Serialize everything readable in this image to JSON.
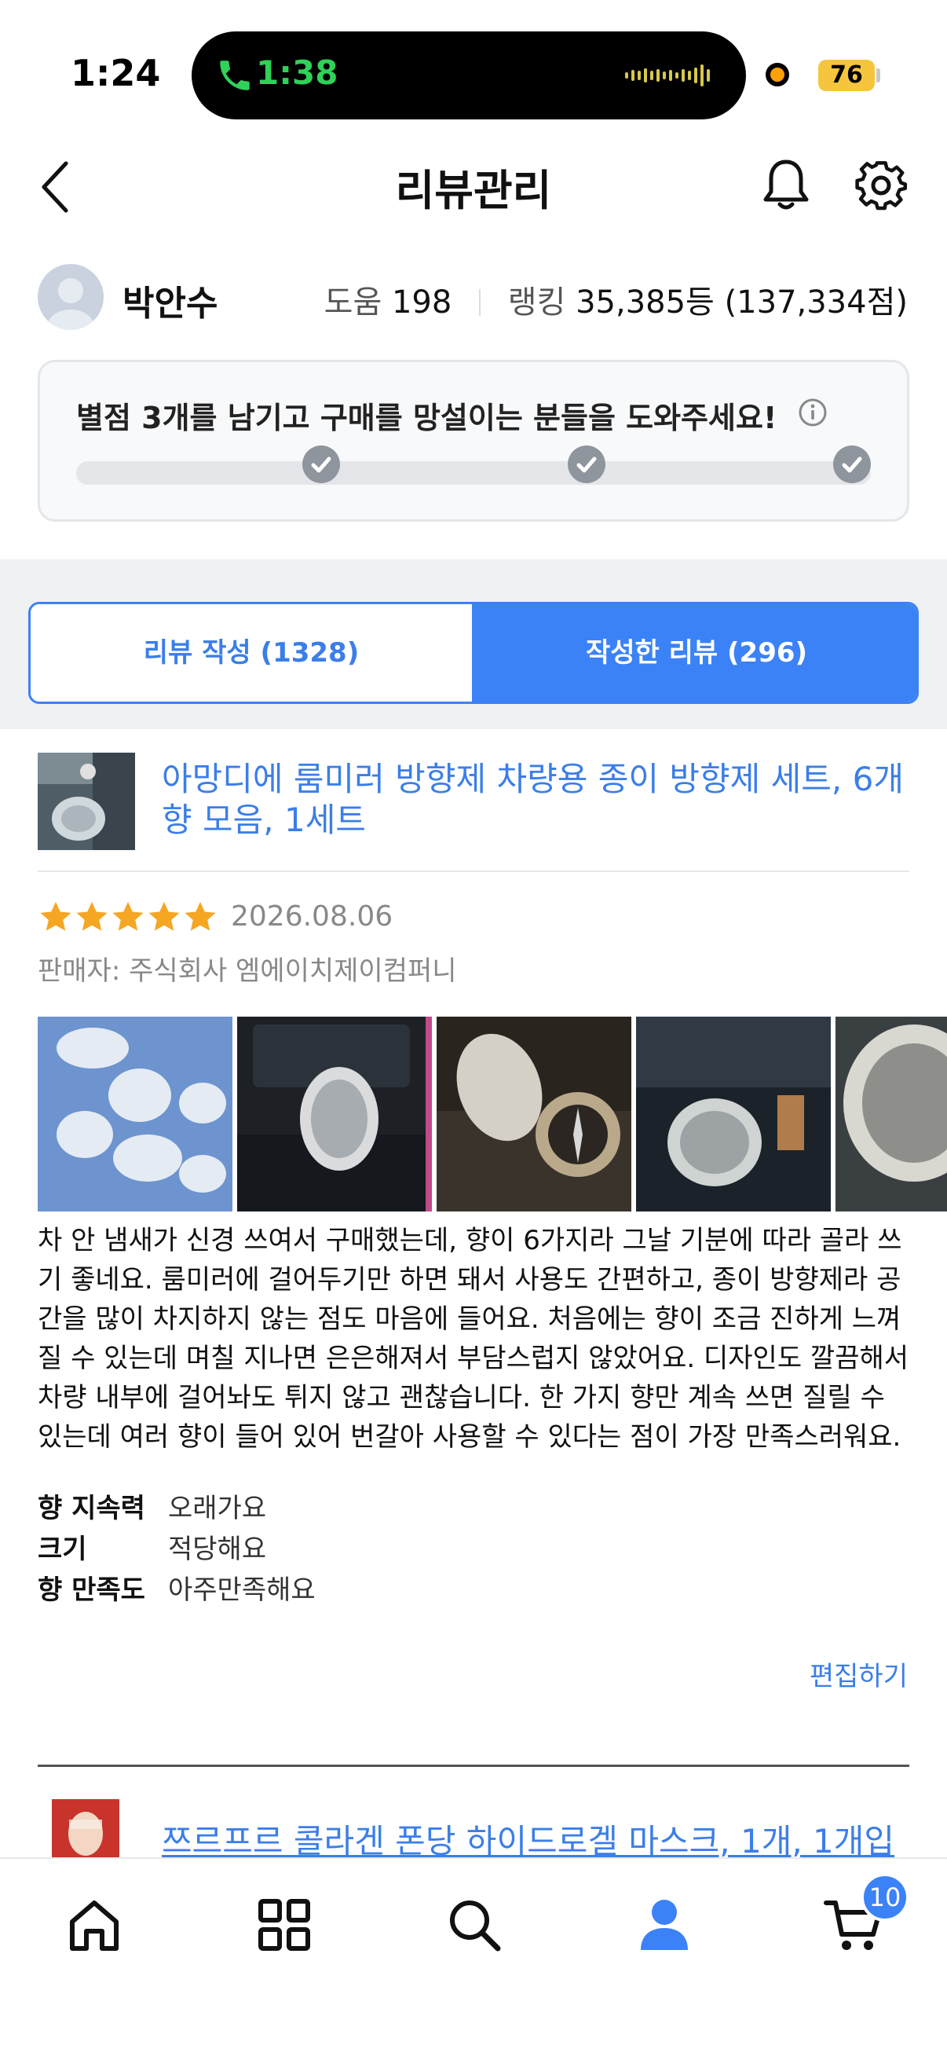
{
  "status_bar": {
    "time": "1:24",
    "call_duration": "1:38",
    "battery": "76"
  },
  "header": {
    "title": "리뷰관리"
  },
  "profile": {
    "name": "박안수",
    "help_label": "도움",
    "help_count": "198",
    "rank_label": "랭킹",
    "rank_value": "35,385등 (137,334점)"
  },
  "progress": {
    "message": "별점 3개를 남기고 구매를 망설이는 분들을 도와주세요!",
    "milestones_completed": 3,
    "milestones_total": 3
  },
  "tabs": [
    {
      "label": "리뷰 작성 (1328)",
      "active": false
    },
    {
      "label": "작성한 리뷰 (296)",
      "active": true
    }
  ],
  "review": {
    "product_title": "아망디에 룸미러 방향제 차량용 종이 방향제 세트, 6개 향 모음, 1세트",
    "rating": 5,
    "rating_max": 5,
    "date": "2026.08.06",
    "seller": "판매자: 주식회사 엠에이치제이컴퍼니",
    "photo_count_visible": 5,
    "body": "차 안 냄새가 신경 쓰여서 구매했는데, 향이 6가지라 그날 기분에 따라 골라 쓰기 좋네요. 룸미러에 걸어두기만 하면 돼서 사용도 간편하고, 종이 방향제라 공간을 많이 차지하지 않는 점도 마음에 들어요. 처음에는 향이 조금 진하게 느껴질 수 있는데 며칠 지나면 은은해져서 부담스럽지 않았어요. 디자인도 깔끔해서 차량 내부에 걸어놔도 튀지 않고 괜찮습니다. 한 가지 향만 계속 쓰면 질릴 수 있는데 여러 향이 들어 있어 번갈아 사용할 수 있다는 점이 가장 만족스러워요.",
    "attributes": [
      {
        "key": "향 지속력",
        "value": "오래가요"
      },
      {
        "key": "크기",
        "value": "적당해요"
      },
      {
        "key": "향 만족도",
        "value": "아주만족해요"
      }
    ],
    "edit_label": "편집하기"
  },
  "next_review": {
    "product_title": "쯔르프르 콜라겐 폰당 하이드로겔 마스크, 1개, 1개입"
  },
  "bottom_nav": {
    "items": [
      "home-icon",
      "category-grid-icon",
      "search-icon",
      "my-page-icon",
      "cart-icon"
    ],
    "active": "my-page-icon",
    "cart_count": "10"
  },
  "colors": {
    "accent": "#3b82f6",
    "link": "#3b7ee8",
    "star": "#f5a623",
    "call_green": "#30d158"
  }
}
